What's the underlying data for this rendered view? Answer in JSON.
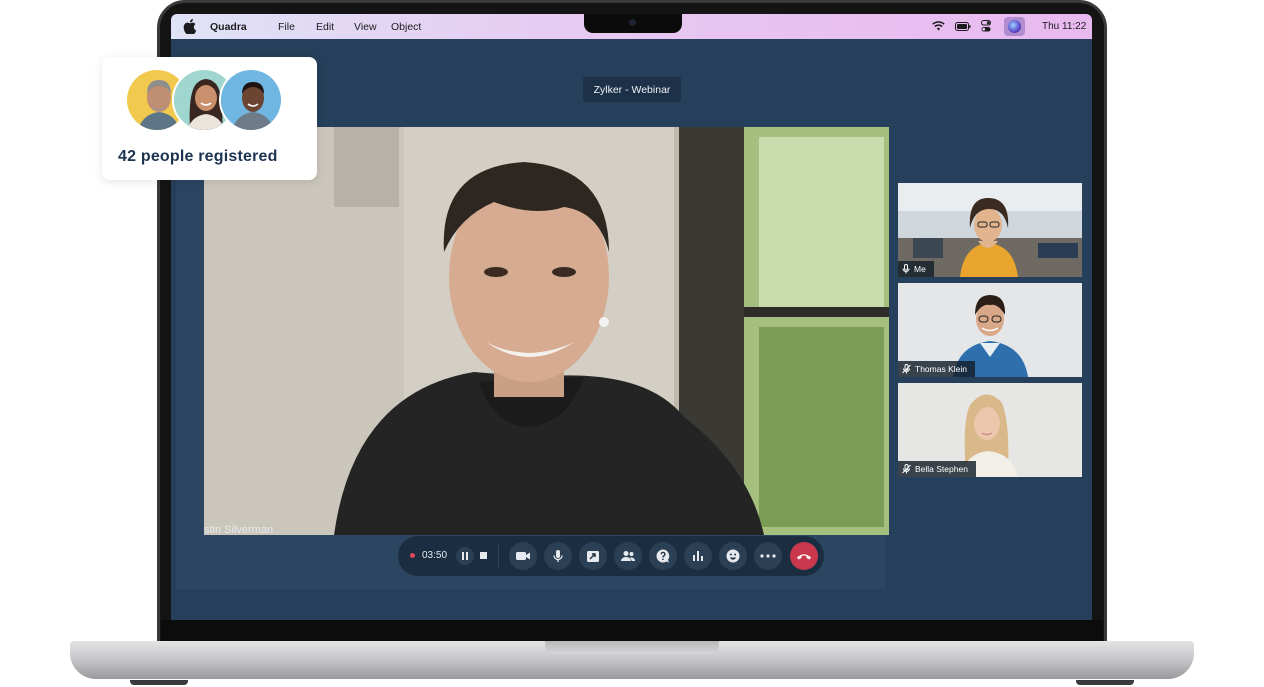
{
  "menubar": {
    "app_name": "Quadra",
    "items": [
      "File",
      "Edit",
      "View",
      "Object"
    ],
    "clock": "Thu 11:22",
    "icons": [
      "apple-icon",
      "wifi-icon",
      "battery-icon",
      "control-center-icon",
      "siri-icon"
    ]
  },
  "webinar": {
    "title": "Zylker - Webinar"
  },
  "main_speaker": {
    "name": "stin Silverman"
  },
  "participants": [
    {
      "name": "Me",
      "mic": "mic-on-icon"
    },
    {
      "name": "Thomas Klein",
      "mic": "mic-muted-icon"
    },
    {
      "name": "Bella Stephen",
      "mic": "mic-muted-icon"
    }
  ],
  "controls": {
    "recording_time": "03:50",
    "buttons": [
      "video-icon",
      "microphone-icon",
      "screen-share-icon",
      "participants-icon",
      "qa-icon",
      "poll-icon",
      "reactions-icon",
      "more-icon",
      "end-call-icon"
    ]
  },
  "registration": {
    "text": "42 people registered"
  },
  "colors": {
    "screen_bg": "#263f5a",
    "accent_end": "#c9384c",
    "brand_text": "#1d3451"
  }
}
